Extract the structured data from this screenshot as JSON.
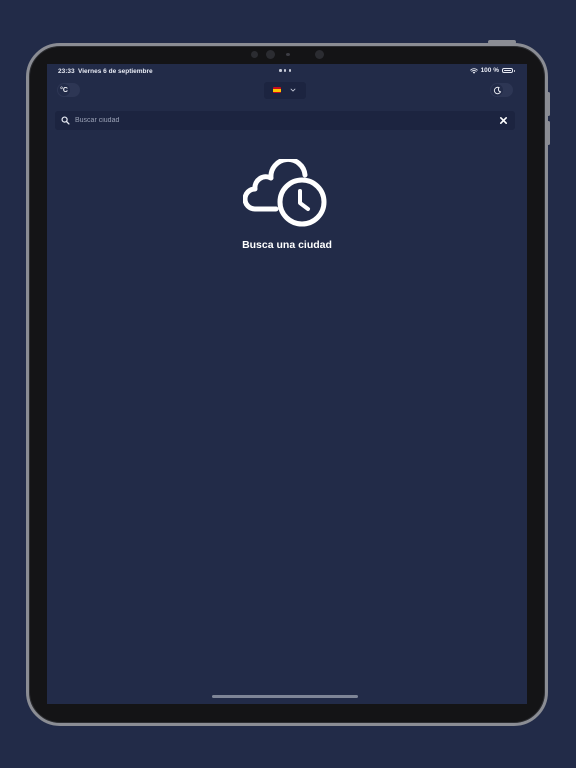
{
  "status_bar": {
    "time": "23:33",
    "date": "Viernes 6 de septiembre",
    "battery": "100 %",
    "wifi_icon": "wifi-icon",
    "battery_icon": "battery-icon"
  },
  "header": {
    "unit_toggle": {
      "label": "°C",
      "icon": "celsius-icon"
    },
    "language_selector": {
      "flag_icon": "spain-flag-icon",
      "chevron_icon": "chevron-down-icon"
    },
    "theme_toggle": {
      "icon": "moon-icon"
    }
  },
  "search": {
    "placeholder": "Buscar ciudad",
    "value": "",
    "search_icon": "magnifier-icon",
    "clear_icon": "close-icon"
  },
  "empty_state": {
    "icon": "cloud-clock-icon",
    "title": "Busca una ciudad"
  },
  "colors": {
    "background": "#222b48",
    "surface": "#1c2440",
    "text": "#ffffff",
    "placeholder": "#9aa1b5"
  }
}
